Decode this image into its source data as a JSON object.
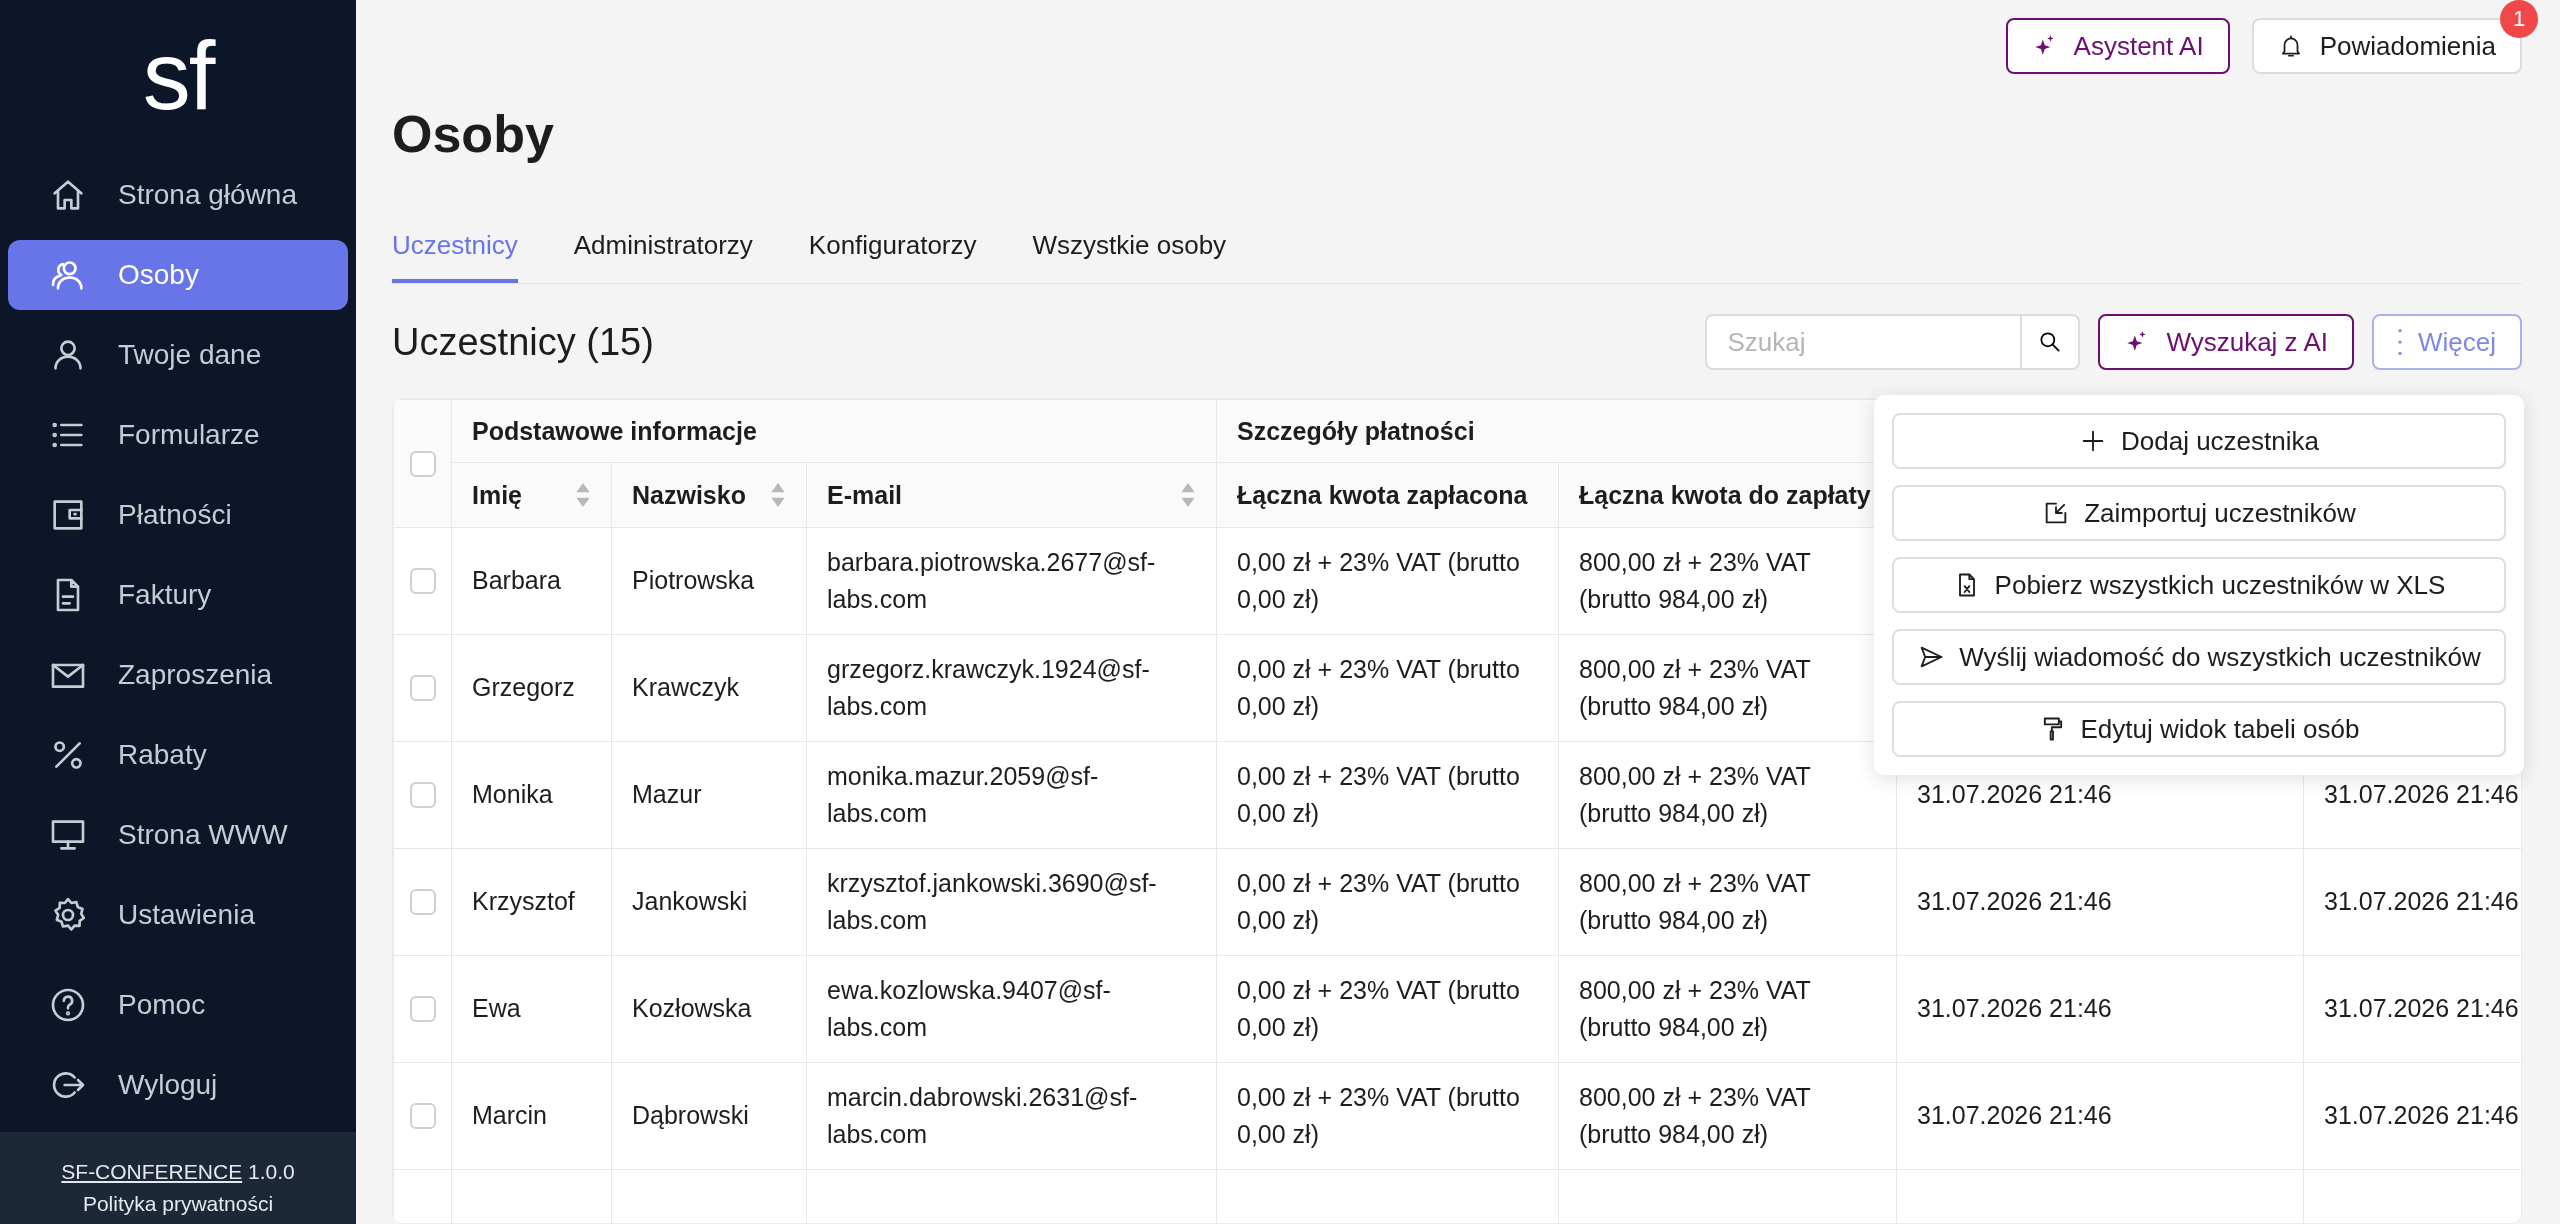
{
  "sidebar": {
    "logo": "sf",
    "items": [
      {
        "label": "Strona główna",
        "selected": false
      },
      {
        "label": "Osoby",
        "selected": true
      },
      {
        "label": "Twoje dane",
        "selected": false
      },
      {
        "label": "Formularze",
        "selected": false
      },
      {
        "label": "Płatności",
        "selected": false
      },
      {
        "label": "Faktury",
        "selected": false
      },
      {
        "label": "Zaproszenia",
        "selected": false
      },
      {
        "label": "Rabaty",
        "selected": false
      },
      {
        "label": "Strona WWW",
        "selected": false
      },
      {
        "label": "Ustawienia",
        "selected": false
      },
      {
        "label": "Pomoc",
        "selected": false
      },
      {
        "label": "Wyloguj",
        "selected": false
      }
    ],
    "footer": {
      "link": "SF-CONFERENCE",
      "version": "1.0.0",
      "privacy": "Polityka prywatności"
    }
  },
  "header": {
    "ai_button": "Asystent AI",
    "notifications": {
      "label": "Powiadomienia",
      "badge": "1"
    }
  },
  "page_title": "Osoby",
  "tabs": [
    {
      "label": "Uczestnicy",
      "selected": true
    },
    {
      "label": "Administratorzy",
      "selected": false
    },
    {
      "label": "Konfiguratorzy",
      "selected": false
    },
    {
      "label": "Wszystkie osoby",
      "selected": false
    }
  ],
  "section": {
    "title": "Uczestnicy (15)",
    "search": {
      "placeholder": "Szukaj"
    },
    "ai_search": "Wyszukaj z AI",
    "more": "Więcej"
  },
  "more_menu": {
    "open": true,
    "items": [
      "Dodaj uczestnika",
      "Zaimportuj uczestników",
      "Pobierz wszystkich uczestników w XLS",
      "Wyślij wiadomość do wszystkich uczestników",
      "Edytuj widok tabeli osób"
    ]
  },
  "table": {
    "select_all_checked": false,
    "column_groups": [
      {
        "label": "Podstawowe informacje",
        "columns": [
          {
            "label": "Imię",
            "sortable": true
          },
          {
            "label": "Nazwisko",
            "sortable": true
          },
          {
            "label": "E-mail",
            "sortable": true
          }
        ]
      },
      {
        "label": "Szczegóły płatności",
        "columns": [
          {
            "label": "Łączna kwota zapłacona",
            "sortable": false
          },
          {
            "label": "Łączna kwota do zapłaty",
            "sortable": false
          }
        ]
      }
    ],
    "rows": [
      {
        "checked": false,
        "first_name": "Barbara",
        "last_name": "Piotrowska",
        "email": "barbara.piotrowska.2677@sf-labs.com",
        "paid": "0,00 zł + 23% VAT (brutto 0,00 zł)",
        "to_pay": "800,00 zł + 23% VAT (brutto 984,00 zł)"
      },
      {
        "checked": false,
        "first_name": "Grzegorz",
        "last_name": "Krawczyk",
        "email": "grzegorz.krawczyk.1924@sf-labs.com",
        "paid": "0,00 zł + 23% VAT (brutto 0,00 zł)",
        "to_pay": "800,00 zł + 23% VAT (brutto 984,00 zł)"
      },
      {
        "checked": false,
        "first_name": "Monika",
        "last_name": "Mazur",
        "email": "monika.mazur.2059@sf-labs.com",
        "paid": "0,00 zł + 23% VAT (brutto 0,00 zł)",
        "to_pay": "800,00 zł + 23% VAT (brutto 984,00 zł)",
        "column_6": "31.07.2026 21:46",
        "column_7": "31.07.2026 21:46"
      },
      {
        "checked": false,
        "first_name": "Krzysztof",
        "last_name": "Jankowski",
        "email": "krzysztof.jankowski.3690@sf-labs.com",
        "paid": "0,00 zł + 23% VAT (brutto 0,00 zł)",
        "to_pay": "800,00 zł + 23% VAT (brutto 984,00 zł)",
        "column_6": "31.07.2026 21:46",
        "column_7": "31.07.2026 21:46"
      },
      {
        "checked": false,
        "first_name": "Ewa",
        "last_name": "Kozłowska",
        "email": "ewa.kozlowska.9407@sf-labs.com",
        "paid": "0,00 zł + 23% VAT (brutto 0,00 zł)",
        "to_pay": "800,00 zł + 23% VAT (brutto 984,00 zł)",
        "column_6": "31.07.2026 21:46",
        "column_7": "31.07.2026 21:46"
      },
      {
        "checked": false,
        "first_name": "Marcin",
        "last_name": "Dąbrowski",
        "email": "marcin.dabrowski.2631@sf-labs.com",
        "paid": "0,00 zł + 23% VAT (brutto 0,00 zł)",
        "to_pay": "800,00 zł + 23% VAT (brutto 984,00 zł)",
        "column_6": "31.07.2026 21:46",
        "column_7": "31.07.2026 21:46"
      }
    ]
  }
}
